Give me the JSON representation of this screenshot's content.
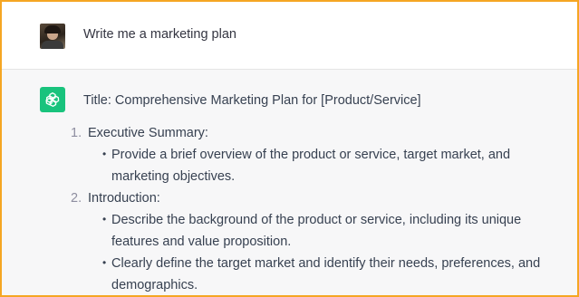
{
  "user_message": {
    "avatar": "user-avatar-photo",
    "text": "Write me a marketing plan"
  },
  "assistant_message": {
    "icon": "openai-logo-icon",
    "icon_color": "#19c37d",
    "title": "Title: Comprehensive Marketing Plan for [Product/Service]",
    "sections": [
      {
        "number": "1.",
        "heading": "Executive Summary:",
        "bullets": [
          "Provide a brief overview of the product or service, target market, and marketing objectives."
        ]
      },
      {
        "number": "2.",
        "heading": "Introduction:",
        "bullets": [
          "Describe the background of the product or service, including its unique features and value proposition.",
          "Clearly define the target market and identify their needs, preferences, and demographics."
        ]
      }
    ]
  },
  "colors": {
    "frame_border": "#f5a623",
    "assistant_bg": "#f7f7f8",
    "text": "#374151"
  }
}
